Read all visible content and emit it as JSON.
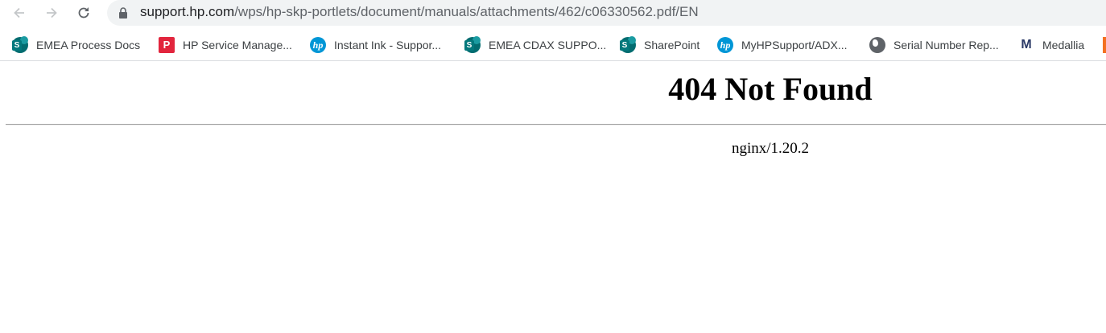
{
  "browser": {
    "address_bar": {
      "host": "support.hp.com",
      "path": "/wps/hp-skp-portlets/document/manuals/attachments/462/c06330562.pdf/EN"
    },
    "nav_icons": [
      "back-arrow-icon",
      "forward-arrow-icon",
      "reload-icon",
      "lock-icon"
    ]
  },
  "bookmarks": [
    {
      "label": "EMEA Process Docs",
      "icon": "sharepoint-icon"
    },
    {
      "label": "HP Service Manage...",
      "icon": "pdf-icon",
      "glyph": "P"
    },
    {
      "label": "Instant Ink - Suppor...",
      "icon": "hp-icon",
      "glyph": "hp"
    },
    {
      "label": "EMEA CDAX SUPPO...",
      "icon": "sharepoint-icon"
    },
    {
      "label": "SharePoint",
      "icon": "sharepoint-icon"
    },
    {
      "label": "MyHPSupport/ADX...",
      "icon": "hp-icon",
      "glyph": "hp"
    },
    {
      "label": "Serial Number Rep...",
      "icon": "globe-icon"
    },
    {
      "label": "Medallia",
      "icon": "medallia-icon",
      "glyph": "M"
    }
  ],
  "page": {
    "heading": "404 Not Found",
    "server": "nginx/1.20.2"
  },
  "colors": {
    "omnibox_bg": "#f1f3f4",
    "sharepoint": "#036c70",
    "hp_blue": "#0096d6",
    "pdf_red": "#e2253d"
  }
}
